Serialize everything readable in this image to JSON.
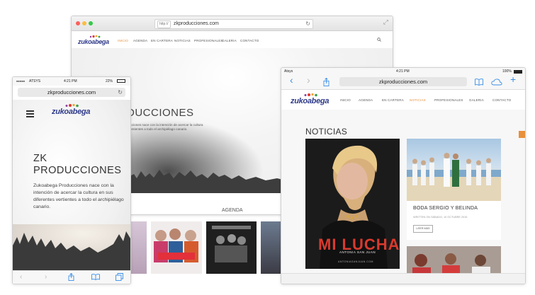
{
  "desktop": {
    "url_proto": "http://",
    "url_host": "zkproducciones.com",
    "nav": [
      "INICIO",
      "AGENDA",
      "EN CARTERA",
      "NOTICIAS",
      "PROFESIONALES",
      "GALERIA",
      "CONTACTO"
    ],
    "active_nav": "INICIO",
    "logo_text": "zukoabega",
    "hero_title": "DUCCIONES",
    "hero_text": "ucciones nace con la intención de acercar la cultura ventientes a todo el archipiélago canario.",
    "section_label": "AGENDA"
  },
  "phone": {
    "carrier": "ATSYS",
    "time": "4:21 PM",
    "battery": "22%",
    "url": "zkproducciones.com",
    "logo_text": "zukoabega",
    "title": "ZK PRODUCCIONES",
    "text": "Zukoabega Producciones nace con la intención de acercar la cultura en sus diferentes vertientes a todo el archipiélago canario.",
    "toolbar_icons": [
      "back-arrow-icon",
      "forward-arrow-icon",
      "share-icon",
      "bookmarks-icon",
      "tabs-icon"
    ]
  },
  "tablet": {
    "carrier": "Atsys",
    "time": "4:21 PM",
    "battery": "100%",
    "url": "zkproducciones.com",
    "logo_text": "zukoabega",
    "nav": [
      "INICIO",
      "AGENDA",
      "EN CARTERA",
      "NOTICIAS",
      "PROFESIONALES",
      "GALERIA",
      "CONTACTO"
    ],
    "active_nav": "NOTICIAS",
    "section_title": "NOTICIAS",
    "poster_title": "MI LUCHA",
    "poster_subtitle": "ANTONIA SAN JUAN",
    "poster_url": "ANTONIASANJUAN.COM",
    "news_title": "BODA SERGIO Y BELINDA",
    "news_meta": "WRITTEN ON SÁBADO, 10 OCTUBRE 2015",
    "read_more": "LEER MÁS"
  },
  "colors": {
    "accent": "#e8903a",
    "ios_blue": "#3a8ee6",
    "poster_red": "#d83a2e"
  }
}
